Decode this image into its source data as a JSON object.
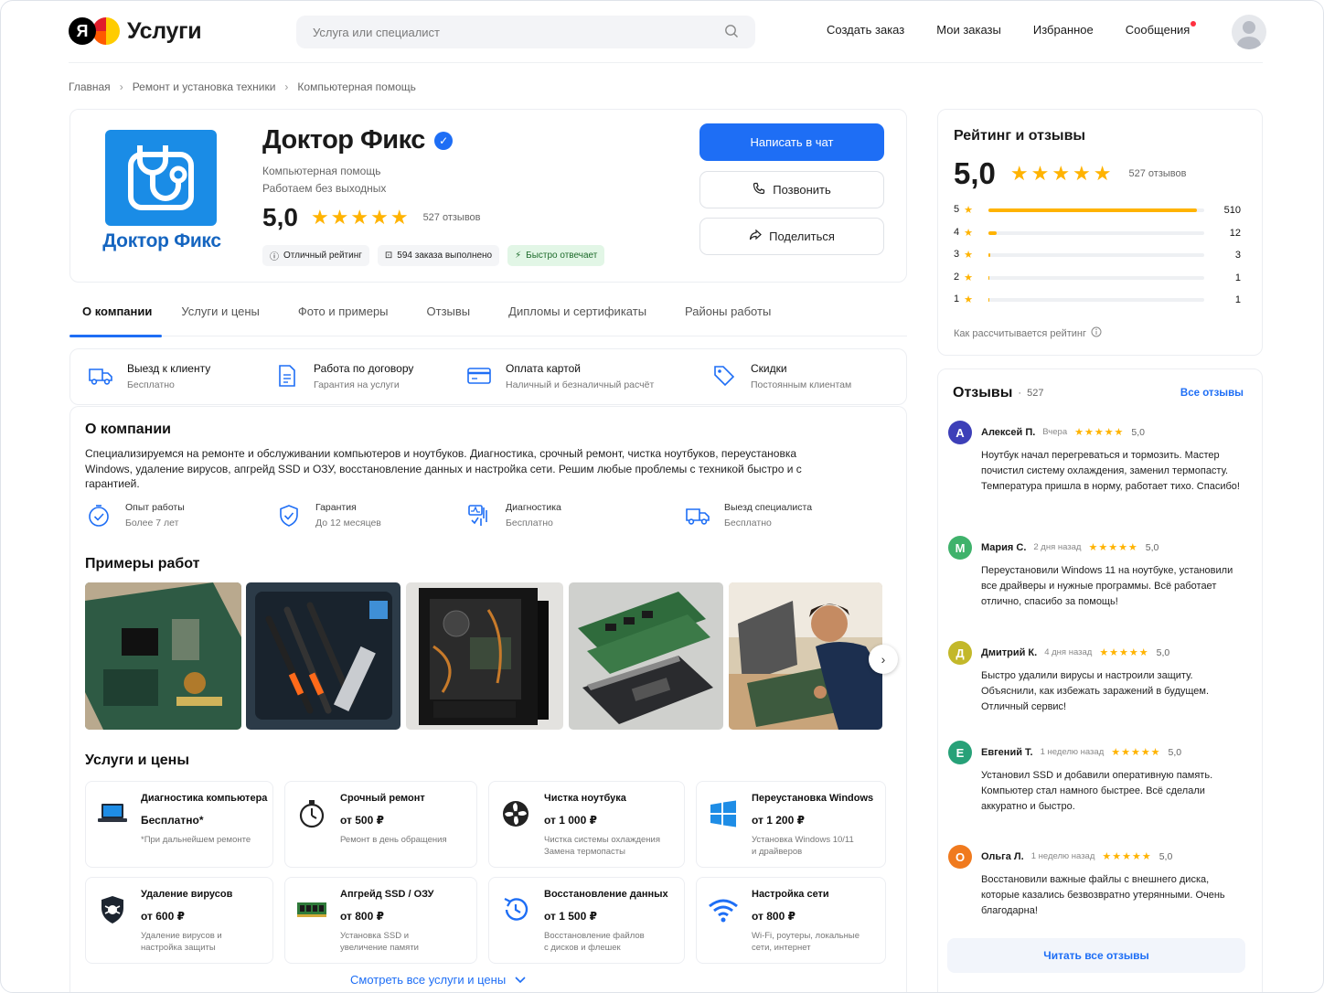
{
  "header": {
    "logo_letter": "Я",
    "logo_text": "Услуги",
    "search_placeholder": "Услуга или специалист",
    "nav": [
      "Создать заказ",
      "Мои заказы",
      "Избранное",
      "Сообщения"
    ]
  },
  "breadcrumbs": [
    "Главная",
    "Ремонт и установка техники",
    "Компьютерная помощь"
  ],
  "profile": {
    "logo_text": "Доктор Фикс",
    "name": "Доктор Фикс",
    "category": "Компьютерная помощь",
    "schedule": "Работаем без выходных",
    "rating": "5,0",
    "stars": "★★★★★",
    "reviews_count": "527 отзывов",
    "badges": [
      "Отличный рейтинг",
      "594 заказа выполнено",
      "Быстро отвечает"
    ],
    "buttons": {
      "chat": "Написать в чат",
      "call": "Позвонить",
      "share": "Поделиться"
    }
  },
  "tabs": [
    "О компании",
    "Услуги и цены",
    "Фото и примеры",
    "Отзывы",
    "Дипломы и сертификаты",
    "Районы работы"
  ],
  "features": [
    {
      "title": "Выезд к клиенту",
      "desc": "Бесплатно"
    },
    {
      "title": "Работа по договору",
      "desc": "Гарантия на услуги"
    },
    {
      "title": "Оплата картой",
      "desc": "Наличный и безналичный расчёт"
    },
    {
      "title": "Скидки",
      "desc": "Постоянным клиентам"
    }
  ],
  "about": {
    "title": "О компании",
    "text": "Специализируемся на ремонте и обслуживании компьютеров и ноутбуков. Диагностика, срочный ремонт, чистка ноутбуков, переустановка Windows, удаление вирусов, апгрейд SSD и ОЗУ, восстановление данных и настройка сети. Решим любые проблемы с техникой быстро и с гарантией.",
    "facts": [
      {
        "title": "Опыт работы",
        "desc": "Более 7 лет"
      },
      {
        "title": "Гарантия",
        "desc": "До 12 месяцев"
      },
      {
        "title": "Диагностика",
        "desc": "Бесплатно"
      },
      {
        "title": "Выезд специалиста",
        "desc": "Бесплатно"
      }
    ]
  },
  "examples_title": "Примеры работ",
  "services_title": "Услуги и цены",
  "services": [
    {
      "name": "Диагностика компьютера",
      "price": "Бесплатно*",
      "desc": "*При дальнейшем ремонте"
    },
    {
      "name": "Срочный ремонт",
      "price": "от 500 ₽",
      "desc": "Ремонт в день обращения"
    },
    {
      "name": "Чистка ноутбука",
      "price": "от 1 000 ₽",
      "desc": "Чистка системы охлаждения\nЗамена термопасты"
    },
    {
      "name": "Переустановка Windows",
      "price": "от 1 200 ₽",
      "desc": "Установка Windows 10/11\nи драйверов"
    },
    {
      "name": "Удаление вирусов",
      "price": "от 600 ₽",
      "desc": "Удаление вирусов и\nнастройка защиты"
    },
    {
      "name": "Апгрейд SSD / ОЗУ",
      "price": "от 800 ₽",
      "desc": "Установка SSD и\nувеличение памяти"
    },
    {
      "name": "Восстановление данных",
      "price": "от 1 500 ₽",
      "desc": "Восстановление файлов\nс дисков и флешек"
    },
    {
      "name": "Настройка сети",
      "price": "от 800 ₽",
      "desc": "Wi-Fi, роутеры, локальные\nсети, интернет"
    }
  ],
  "services_more": "Смотреть все услуги и цены",
  "rating_panel": {
    "title": "Рейтинг и отзывы",
    "rating": "5,0",
    "stars": "★★★★★",
    "count": "527 отзывов",
    "bars": [
      {
        "star": "5",
        "count": 510,
        "fraction": 0.968
      },
      {
        "star": "4",
        "count": 12,
        "fraction": 0.04
      },
      {
        "star": "3",
        "count": 3,
        "fraction": 0.01
      },
      {
        "star": "2",
        "count": 1,
        "fraction": 0.005
      },
      {
        "star": "1",
        "count": 1,
        "fraction": 0.005
      }
    ],
    "how": "Как рассчитывается рейтинг"
  },
  "reviews": {
    "title": "Отзывы",
    "count": "527",
    "all_link": "Все отзывы",
    "items": [
      {
        "initial": "А",
        "name": "Алексей П.",
        "time": "Вчера",
        "stars": "★★★★★",
        "score": "5,0",
        "text": "Ноутбук начал перегреваться и тормозить. Мастер почистил систему охлаждения, заменил термопасту. Температура пришла в норму, работает тихо. Спасибо!",
        "color": "#3d3fb8"
      },
      {
        "initial": "М",
        "name": "Мария С.",
        "time": "2 дня назад",
        "stars": "★★★★★",
        "score": "5,0",
        "text": "Переустановили Windows 11 на ноутбуке, установили все драйверы и нужные программы. Всё работает отлично, спасибо за помощь!",
        "color": "#3fb26b"
      },
      {
        "initial": "Д",
        "name": "Дмитрий К.",
        "time": "4 дня назад",
        "stars": "★★★★★",
        "score": "5,0",
        "text": "Быстро удалили вирусы и настроили защиту. Объяснили, как избежать заражений в будущем. Отличный сервис!",
        "color": "#c3b82a"
      },
      {
        "initial": "Е",
        "name": "Евгений Т.",
        "time": "1 неделю назад",
        "stars": "★★★★★",
        "score": "5,0",
        "text": "Установил SSD и добавили оперативную память. Компьютер стал намного быстрее. Всё сделали аккуратно и быстро.",
        "color": "#27a178"
      },
      {
        "initial": "О",
        "name": "Ольга Л.",
        "time": "1 неделю назад",
        "stars": "★★★★★",
        "score": "5,0",
        "text": "Восстановили важные файлы с внешнего диска, которые казались безвозвратно утерянными. Очень благодарна!",
        "color": "#f07a1e"
      }
    ],
    "read_all": "Читать все отзывы"
  }
}
